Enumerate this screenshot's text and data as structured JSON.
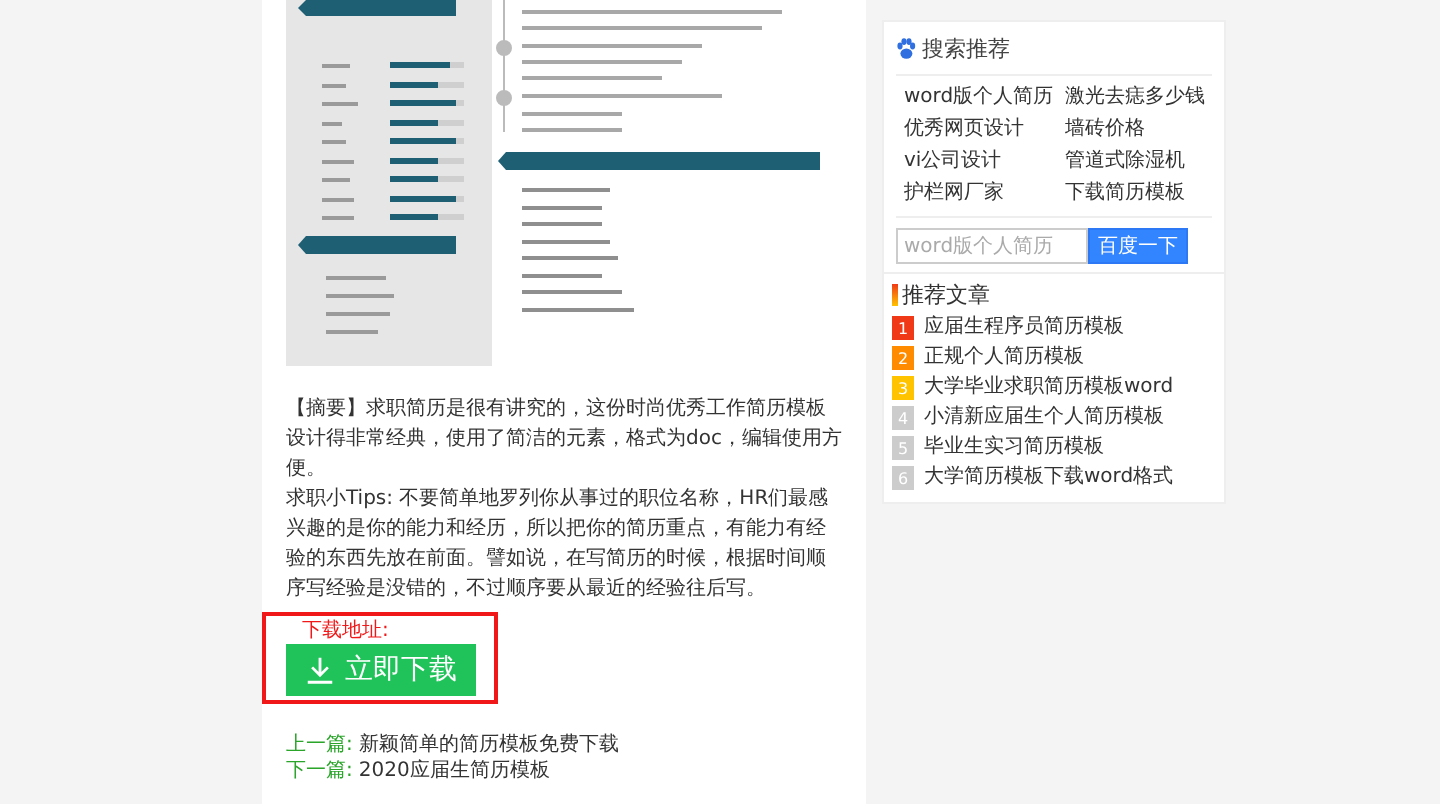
{
  "summary": [
    "【摘要】求职简历是很有讲究的，这份时尚优秀工作简历模板设计得非常经典，使用了简洁的元素，格式为doc，编辑使用方便。",
    "求职小Tips: 不要简单地罗列你从事过的职位名称，HR们最感兴趣的是你的能力和经历，所以把你的简历重点，有能力有经验的东西先放在前面。譬如说，在写简历的时候，根据时间顺序写经验是没错的，不过顺序要从最近的经验往后写。"
  ],
  "download": {
    "label": "下载地址:",
    "button": "立即下载"
  },
  "nav": [
    {
      "label": "上一篇:",
      "title": "新颖简单的简历模板免费下载"
    },
    {
      "label": "下一篇:",
      "title": "2020应届生简历模板"
    }
  ],
  "search_box": {
    "title": "搜索推荐",
    "links": [
      "word版个人简历",
      "激光去痣多少钱",
      "优秀网页设计",
      "墙砖价格",
      "vi公司设计",
      "管道式除湿机",
      "护栏网厂家",
      "下载简历模板"
    ],
    "placeholder": "word版个人简历",
    "button": "百度一下"
  },
  "articles": {
    "title": "推荐文章",
    "items": [
      {
        "rank": "1",
        "title": "应届生程序员简历模板",
        "color": "#f03a17"
      },
      {
        "rank": "2",
        "title": "正规个人简历模板",
        "color": "#ff8c00"
      },
      {
        "rank": "3",
        "title": "大学毕业求职简历模板word",
        "color": "#ffc300"
      },
      {
        "rank": "4",
        "title": "小清新应届生个人简历模板",
        "color": "#cccccc"
      },
      {
        "rank": "5",
        "title": "毕业生实习简历模板",
        "color": "#cccccc"
      },
      {
        "rank": "6",
        "title": "大学简历模板下载word格式",
        "color": "#cccccc"
      }
    ]
  }
}
